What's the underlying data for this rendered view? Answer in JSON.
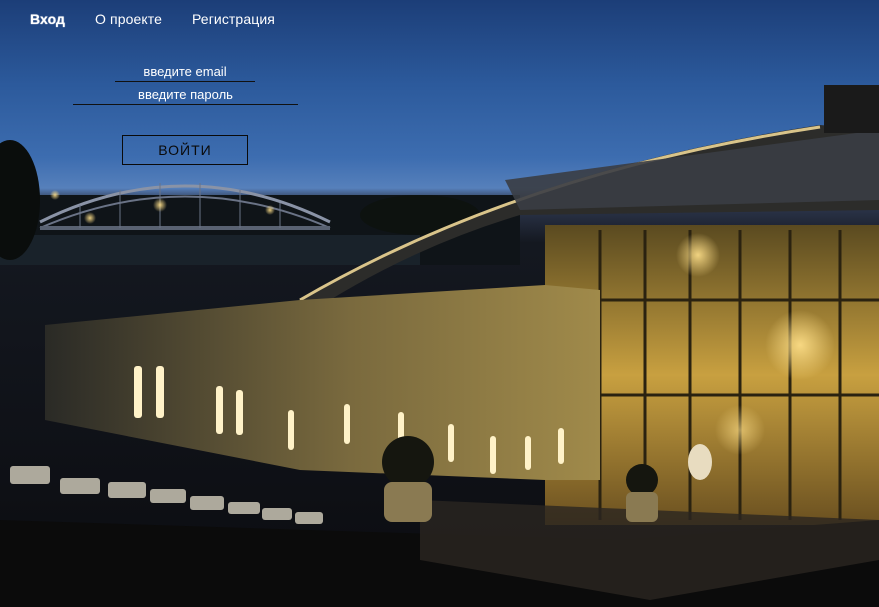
{
  "nav": {
    "items": [
      {
        "label": "Вход",
        "active": true
      },
      {
        "label": "О проекте",
        "active": false
      },
      {
        "label": "Регистрация",
        "active": false
      }
    ]
  },
  "login": {
    "email_placeholder": "введите email",
    "password_placeholder": "введите пароль",
    "submit_label": "ВОЙТИ"
  },
  "colors": {
    "text": "#ffffff",
    "button_border": "#0a0a0a",
    "sky_top": "#1c3e78",
    "lights": "#f2c24a"
  }
}
